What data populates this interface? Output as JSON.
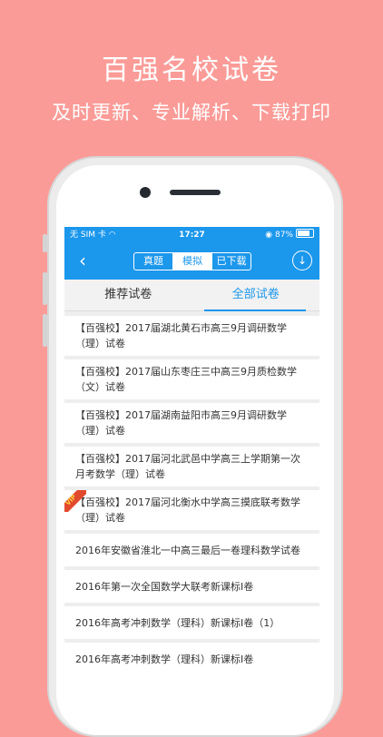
{
  "promo": {
    "title": "百强名校试卷",
    "subtitle": "及时更新、专业解析、下载打印"
  },
  "status": {
    "carrier": "无 SIM 卡",
    "time": "17:27",
    "battery": "87%"
  },
  "nav": {
    "segments": [
      "真题",
      "模拟",
      "已下载"
    ],
    "active_segment": "模拟"
  },
  "tabs": [
    "推荐试卷",
    "全部试卷"
  ],
  "selected_tab": "全部试卷",
  "items": [
    {
      "text": "【百强校】2017届湖北黄石市高三9月调研数学（理）试卷",
      "vip": false
    },
    {
      "text": "【百强校】2017届山东枣庄三中高三9月质检数学（文）试卷",
      "vip": false
    },
    {
      "text": "【百强校】2017届湖南益阳市高三9月调研数学（理）试卷",
      "vip": false
    },
    {
      "text": "【百强校】2017届河北武邑中学高三上学期第一次月考数学（理）试卷",
      "vip": false
    },
    {
      "text": "【百强校】2017届河北衡水中学高三摸底联考数学（理）试卷",
      "vip": true,
      "badge": "VIP"
    },
    {
      "text": "2016年安徽省淮北一中高三最后一卷理科数学试卷",
      "vip": false
    },
    {
      "text": "2016年第一次全国数学大联考新课标Ⅰ卷",
      "vip": false
    },
    {
      "text": "2016年高考冲刺数学（理科）新课标Ⅰ卷（1）",
      "vip": false
    },
    {
      "text": "2016年高考冲刺数学（理科）新课标Ⅰ卷",
      "vip": false
    }
  ],
  "colors": {
    "background": "#fb9b97",
    "accent": "#1b97ec"
  }
}
